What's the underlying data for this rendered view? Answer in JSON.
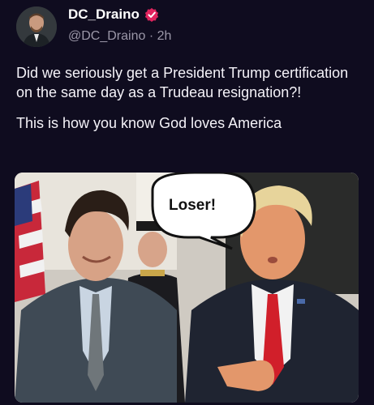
{
  "author": {
    "display_name": "DC_Draino",
    "handle": "@DC_Draino",
    "separator": " · ",
    "time": "2h",
    "verified": true,
    "verified_color": "#e0245e"
  },
  "post": {
    "paragraphs": [
      "Did we seriously get a President Trump certification on the same day as a Trudeau resignation?!",
      "This is how you know God loves America"
    ]
  },
  "media": {
    "speech_bubble": "Loser!"
  },
  "colors": {
    "background": "#0f0c1f",
    "muted_text": "#9b97a8"
  }
}
